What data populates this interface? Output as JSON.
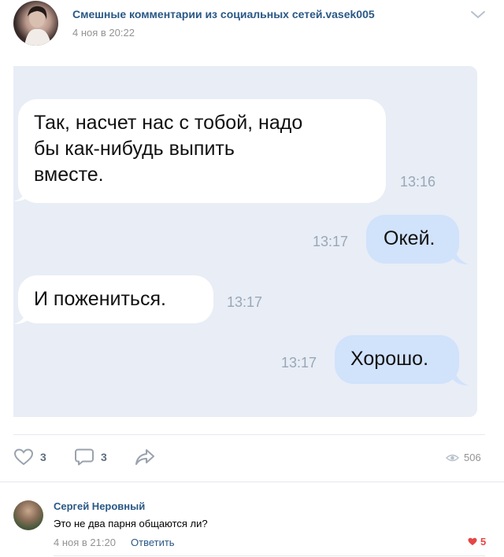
{
  "post": {
    "author": "Смешные комментарии из социальных сетей.vasek005",
    "date": "4 ноя в 20:22"
  },
  "chat": {
    "messages": [
      {
        "side": "in",
        "lines": [
          "Так, насчет нас с тобой, надо",
          "бы как-нибудь выпить",
          "вместе."
        ],
        "time": "13:16"
      },
      {
        "side": "out",
        "lines": [
          "Окей."
        ],
        "time": "13:17"
      },
      {
        "side": "in",
        "lines": [
          "И пожениться."
        ],
        "time": "13:17"
      },
      {
        "side": "out",
        "lines": [
          "Хорошо."
        ],
        "time": "13:17"
      }
    ]
  },
  "actions": {
    "likes": "3",
    "comments": "3",
    "views": "506"
  },
  "comment": {
    "author": "Сергей Неровный",
    "text": "Это не два парня общаются ли?",
    "date": "4 ноя в 21:20",
    "reply_label": "Ответить",
    "likes": "5"
  },
  "colors": {
    "link": "#2a5885",
    "incoming_bubble": "#ffffff",
    "outgoing_bubble": "#d1e2fb",
    "chat_background": "#e8edf6",
    "like_red": "#e64646"
  },
  "icons": [
    "chevron-down-icon",
    "heart-icon",
    "comment-icon",
    "share-icon",
    "eye-icon",
    "heart-filled-icon"
  ]
}
